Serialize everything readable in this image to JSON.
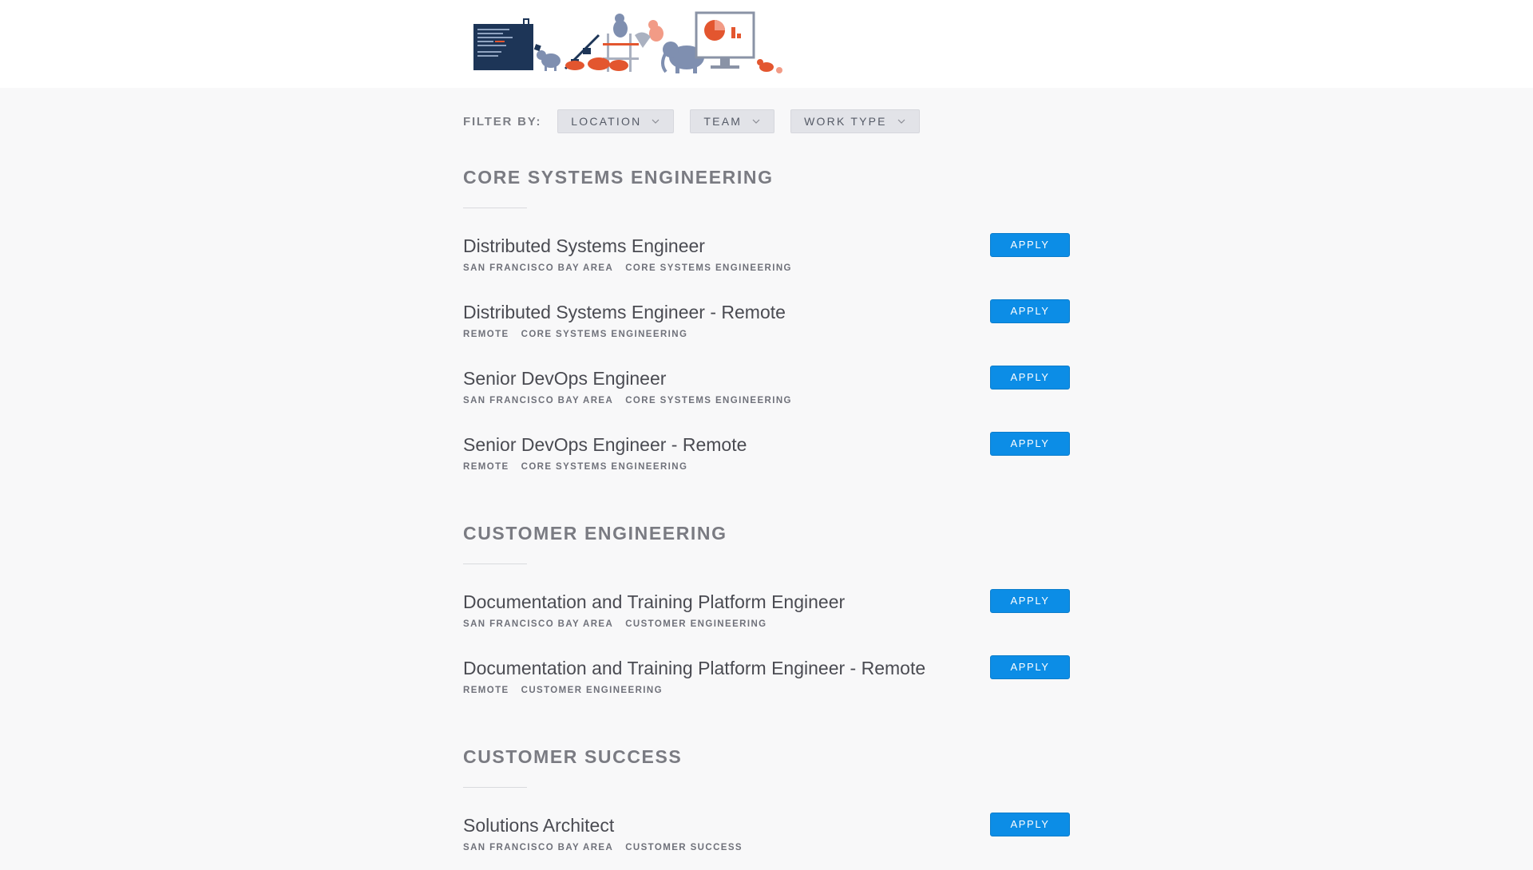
{
  "filter": {
    "label": "FILTER BY:",
    "dropdowns": [
      {
        "label": "LOCATION",
        "icon": "chevron-down-icon"
      },
      {
        "label": "TEAM",
        "icon": "chevron-down-icon"
      },
      {
        "label": "WORK TYPE",
        "icon": "chevron-down-icon"
      }
    ]
  },
  "apply_label": "APPLY",
  "colors": {
    "apply_blue": "#0c8de6",
    "page_bg": "#f8f8f9",
    "section_title": "#7a7b82",
    "illustration_accent": "#e3562f",
    "illustration_navy": "#1d3557"
  },
  "sections": [
    {
      "title": "CORE SYSTEMS ENGINEERING",
      "postings": [
        {
          "title": "Distributed Systems Engineer",
          "location": "SAN FRANCISCO BAY AREA",
          "team": "CORE SYSTEMS ENGINEERING"
        },
        {
          "title": "Distributed Systems Engineer - Remote",
          "location": "REMOTE",
          "team": "CORE SYSTEMS ENGINEERING"
        },
        {
          "title": "Senior DevOps Engineer",
          "location": "SAN FRANCISCO BAY AREA",
          "team": "CORE SYSTEMS ENGINEERING"
        },
        {
          "title": "Senior DevOps Engineer - Remote",
          "location": "REMOTE",
          "team": "CORE SYSTEMS ENGINEERING"
        }
      ]
    },
    {
      "title": "CUSTOMER ENGINEERING",
      "postings": [
        {
          "title": "Documentation and Training Platform Engineer",
          "location": "SAN FRANCISCO BAY AREA",
          "team": "CUSTOMER ENGINEERING"
        },
        {
          "title": "Documentation and Training Platform Engineer - Remote",
          "location": "REMOTE",
          "team": "CUSTOMER ENGINEERING"
        }
      ]
    },
    {
      "title": "CUSTOMER SUCCESS",
      "postings": [
        {
          "title": "Solutions Architect",
          "location": "SAN FRANCISCO BAY AREA",
          "team": "CUSTOMER SUCCESS"
        }
      ]
    }
  ]
}
